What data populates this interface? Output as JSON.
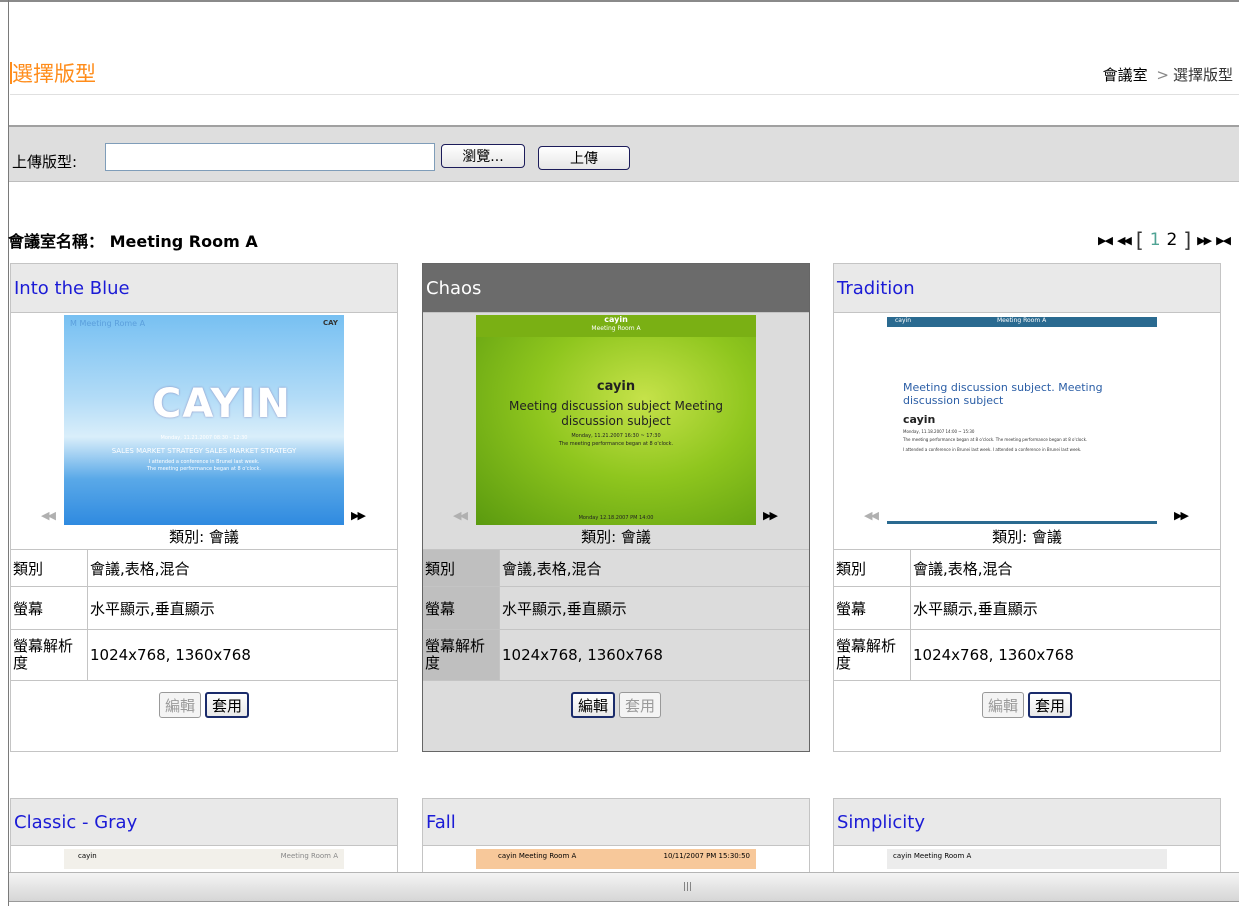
{
  "header": {
    "title": "選擇版型",
    "breadcrumb": [
      "會議室",
      "選擇版型"
    ],
    "breadcrumb_sep": ">"
  },
  "upload": {
    "label": "上傳版型:",
    "input_value": "",
    "browse_label": "瀏覽...",
    "upload_label": "上傳"
  },
  "room": {
    "label": "會議室名稱：",
    "name": "Meeting Room A"
  },
  "pager": {
    "pages": [
      "1",
      "2"
    ],
    "current": "1",
    "open_bracket": "[",
    "close_bracket": "]"
  },
  "cards": [
    {
      "name": "Into the Blue",
      "selected": false,
      "category_line": "類別: 會議",
      "specs": [
        {
          "k": "類別",
          "v": "會議,表格,混合"
        },
        {
          "k": "螢幕",
          "v": "水平顯示,垂直顯示"
        },
        {
          "k": "螢幕解析度",
          "v": "1024x768, 1360x768"
        }
      ],
      "edit_label": "編輯",
      "apply_label": "套用",
      "edit_enabled": false,
      "apply_enabled": true,
      "thumb": {
        "header": "M Meeting Rome A",
        "logo": "CAYIN",
        "date": "Monday, 11.21.2007 08:30 - 12:30",
        "subject": "SALES MARKET STRATEGY SALES MARKET STRATEGY",
        "note1": "I attended a conference in Brunei last week.",
        "note2": "The meeting performance began at 8 o'clock."
      }
    },
    {
      "name": "Chaos",
      "selected": true,
      "category_line": "類別: 會議",
      "specs": [
        {
          "k": "類別",
          "v": "會議,表格,混合"
        },
        {
          "k": "螢幕",
          "v": "水平顯示,垂直顯示"
        },
        {
          "k": "螢幕解析度",
          "v": "1024x768, 1360x768"
        }
      ],
      "edit_label": "編輯",
      "apply_label": "套用",
      "edit_enabled": true,
      "apply_enabled": false,
      "thumb": {
        "header1": "cayin",
        "header2": "Meeting Room A",
        "logo": "cayin",
        "subject": "Meeting discussion subject Meeting discussion subject",
        "date": "Monday, 11.21.2007 16:30 ~ 17:30",
        "note": "The meeting performance began at 8 o'clock.",
        "footer": "Monday   12.18.2007   PM 14:00"
      }
    },
    {
      "name": "Tradition",
      "selected": false,
      "category_line": "類別: 會議",
      "specs": [
        {
          "k": "類別",
          "v": "會議,表格,混合"
        },
        {
          "k": "螢幕",
          "v": "水平顯示,垂直顯示"
        },
        {
          "k": "螢幕解析度",
          "v": "1024x768, 1360x768"
        }
      ],
      "edit_label": "編輯",
      "apply_label": "套用",
      "edit_enabled": false,
      "apply_enabled": true,
      "thumb": {
        "header_left": "cayin",
        "header_mid": "Meeting Room A",
        "subject": "Meeting discussion subject. Meeting discussion subject",
        "logo": "cayin",
        "date": "Monday, 11.18.2007 14:00 ~ 15:30",
        "note1": "The meeting performance began at 8 o'clock. The meeting performance began at 8 o'clock.",
        "note2": "I attended a conference in Brunei last week. I attended a conference in Brunei last week."
      }
    }
  ],
  "cards_row2": [
    {
      "name": "Classic - Gray",
      "thumb_left": "cayin",
      "thumb_right": "Meeting Room A"
    },
    {
      "name": "Fall",
      "thumb_left": "cayin  Meeting Room A",
      "thumb_right": "10/11/2007  PM 15:30:50"
    },
    {
      "name": "Simplicity",
      "thumb_left": "cayin  Meeting Room A",
      "thumb_right": ""
    }
  ],
  "scrollbar": {
    "grip": "|||"
  }
}
